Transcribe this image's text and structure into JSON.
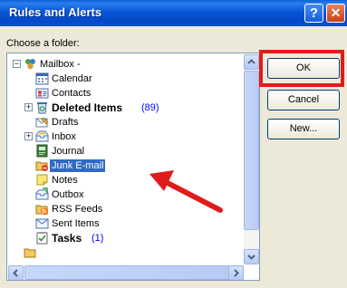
{
  "window": {
    "title": "Rules and Alerts",
    "help_glyph": "?",
    "close_glyph": "✕"
  },
  "panel": {
    "choose_label": "Choose a folder:"
  },
  "tree": [
    {
      "label": "Mailbox -",
      "icon": "mailbox-icon",
      "expander": "−"
    },
    {
      "label": "Calendar",
      "icon": "calendar-icon"
    },
    {
      "label": "Contacts",
      "icon": "contacts-icon"
    },
    {
      "label": "Deleted Items",
      "count": "(89)",
      "icon": "deleted-items-icon",
      "expander": "+",
      "bold": true
    },
    {
      "label": "Drafts",
      "icon": "drafts-icon"
    },
    {
      "label": "Inbox",
      "icon": "inbox-icon",
      "expander": "+"
    },
    {
      "label": "Journal",
      "icon": "journal-icon"
    },
    {
      "label": "Junk E-mail",
      "icon": "junk-email-icon",
      "selected": true
    },
    {
      "label": "Notes",
      "icon": "notes-icon"
    },
    {
      "label": "Outbox",
      "icon": "outbox-icon"
    },
    {
      "label": "RSS Feeds",
      "icon": "rss-feeds-icon"
    },
    {
      "label": "Sent Items",
      "icon": "sent-items-icon"
    },
    {
      "label": "Tasks",
      "count": "(1)",
      "icon": "tasks-icon",
      "bold": true
    }
  ],
  "buttons": {
    "ok": "OK",
    "cancel": "Cancel",
    "new": "New..."
  },
  "colors": {
    "highlight": "#e01b1b",
    "selection": "#316ac5",
    "count": "#0000ff"
  }
}
